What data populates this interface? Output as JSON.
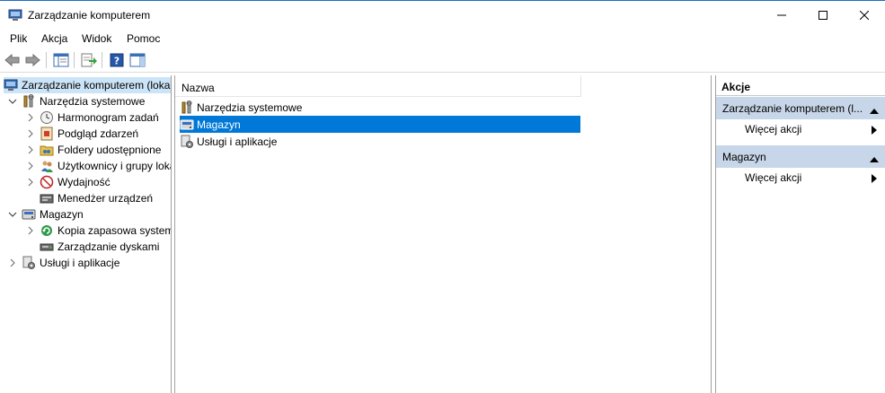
{
  "window": {
    "title": "Zarządzanie komputerem"
  },
  "menu": {
    "items": [
      "Plik",
      "Akcja",
      "Widok",
      "Pomoc"
    ]
  },
  "tree": {
    "root": "Zarządzanie komputerem (lokalny)",
    "system_tools": "Narzędzia systemowe",
    "task_scheduler": "Harmonogram zadań",
    "event_viewer": "Podgląd zdarzeń",
    "shared_folders": "Foldery udostępnione",
    "local_users": "Użytkownicy i grupy lokalne",
    "performance": "Wydajność",
    "device_manager": "Menedżer urządzeń",
    "storage": "Magazyn",
    "backup": "Kopia zapasowa systemu Windows Server",
    "disk_management": "Zarządzanie dyskami",
    "services_apps": "Usługi i aplikacje"
  },
  "list": {
    "column_name": "Nazwa",
    "rows": [
      "Narzędzia systemowe",
      "Magazyn",
      "Usługi i aplikacje"
    ],
    "selected_index": 1
  },
  "actions": {
    "title": "Akcje",
    "section1": "Zarządzanie komputerem (l...",
    "section1_item": "Więcej akcji",
    "section2": "Magazyn",
    "section2_item": "Więcej akcji"
  },
  "colors": {
    "selection": "#0078d7",
    "tree_root_highlight": "#cce4f7",
    "action_section_bg": "#c7d6e8"
  }
}
